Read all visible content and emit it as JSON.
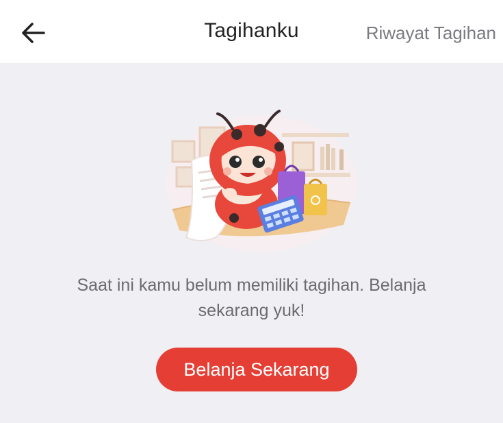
{
  "header": {
    "title": "Tagihanku",
    "history_link": "Riwayat Tagihan",
    "back_icon": "arrow-left-icon"
  },
  "empty_state": {
    "illustration": "ladybug-mascot-with-receipt-illustration",
    "message": "Saat ini kamu belum memiliki tagihan. Belanja sekarang yuk!",
    "cta_label": "Belanja Sekarang"
  },
  "colors": {
    "background": "#efeff4",
    "header_bg": "#ffffff",
    "accent": "#e53f35",
    "text_primary": "#222222",
    "text_secondary": "#6b6b70"
  }
}
